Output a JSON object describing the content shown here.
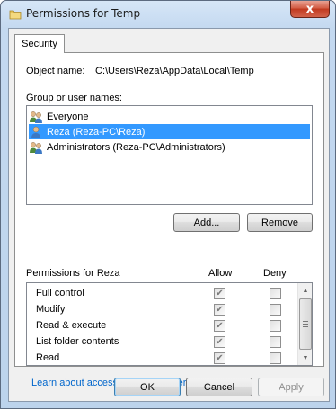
{
  "window": {
    "title": "Permissions for Temp",
    "close_glyph": "x"
  },
  "tabs": [
    {
      "label": "Security"
    }
  ],
  "object": {
    "label": "Object name:",
    "value": "C:\\Users\\Reza\\AppData\\Local\\Temp"
  },
  "groups": {
    "label": "Group or user names:",
    "items": [
      {
        "label": "Everyone",
        "icon": "users-group-icon",
        "selected": false
      },
      {
        "label": "Reza (Reza-PC\\Reza)",
        "icon": "user-icon",
        "selected": true
      },
      {
        "label": "Administrators (Reza-PC\\Administrators)",
        "icon": "users-group-icon",
        "selected": false
      }
    ]
  },
  "buttons": {
    "add": "Add...",
    "remove": "Remove",
    "ok": "OK",
    "cancel": "Cancel",
    "apply": "Apply"
  },
  "permissions": {
    "label": "Permissions for Reza",
    "allow_header": "Allow",
    "deny_header": "Deny",
    "rows": [
      {
        "name": "Full control",
        "allow": true,
        "deny": false
      },
      {
        "name": "Modify",
        "allow": true,
        "deny": false
      },
      {
        "name": "Read & execute",
        "allow": true,
        "deny": false
      },
      {
        "name": "List folder contents",
        "allow": true,
        "deny": false
      },
      {
        "name": "Read",
        "allow": true,
        "deny": false
      }
    ]
  },
  "link": "Learn about access control and permissions",
  "colors": {
    "selection": "#3399ff",
    "link": "#0066cc",
    "close": "#c13a20"
  }
}
